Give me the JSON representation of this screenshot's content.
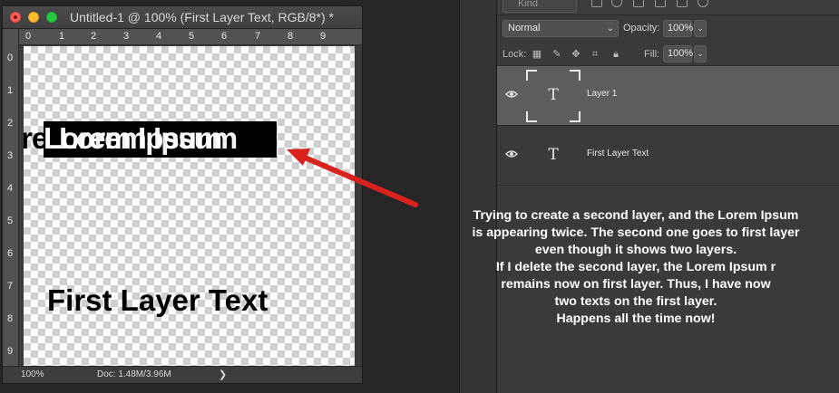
{
  "document": {
    "title": "Untitled-1 @ 100% (First Layer Text, RGB/8*) *",
    "ruler_h_numbers": [
      "0",
      "1",
      "2",
      "3",
      "4",
      "5",
      "6",
      "7",
      "8",
      "9"
    ],
    "ruler_v_numbers": [
      "0",
      "1",
      "2",
      "3",
      "4",
      "5",
      "6",
      "7",
      "8",
      "9"
    ],
    "canvas": {
      "ghost_text": "re",
      "selected_text_a": "Lorem Ipsum",
      "selected_text_b": "Lorem Ipsum",
      "first_layer_text": "First Layer Text"
    },
    "status": {
      "zoom": "100%",
      "doc_size": "Doc: 1.48M/3.96M",
      "arrow": "❯"
    }
  },
  "layers_panel": {
    "filter": {
      "kind_placeholder": "Kind"
    },
    "blend_mode": "Normal",
    "opacity_label": "Opacity:",
    "opacity_value": "100%",
    "lock_label": "Lock:",
    "fill_label": "Fill:",
    "fill_value": "100%",
    "layers": [
      {
        "name": "Layer 1",
        "type_glyph": "T",
        "selected": true
      },
      {
        "name": "First Layer Text",
        "type_glyph": "T",
        "selected": false
      }
    ]
  },
  "annotation": {
    "lines": [
      "Trying to create a second layer, and the  Lorem Ipsum",
      "is appearing twice. The second one goes to first layer",
      "even though it shows two layers.",
      "If I delete the second layer, the Lorem Ipsum r",
      "remains now on first layer. Thus, I have now",
      "two texts on the first layer.",
      "Happens all the time now!"
    ],
    "arrow_color": "#d9211e"
  }
}
